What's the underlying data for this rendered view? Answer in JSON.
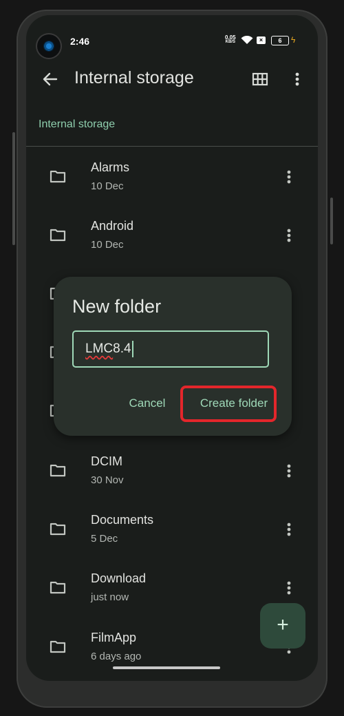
{
  "status_bar": {
    "time": "2:46",
    "net_speed": "0.05",
    "net_unit": "KB/S",
    "battery_level": "6"
  },
  "app_bar": {
    "title": "Internal storage"
  },
  "breadcrumb": "Internal storage",
  "folders": [
    {
      "name": "Alarms",
      "date": "10 Dec"
    },
    {
      "name": "Android",
      "date": "10 Dec"
    },
    {
      "name": "",
      "date": ""
    },
    {
      "name": "",
      "date": ""
    },
    {
      "name": "",
      "date": ""
    },
    {
      "name": "DCIM",
      "date": "30 Nov"
    },
    {
      "name": "Documents",
      "date": "5 Dec"
    },
    {
      "name": "Download",
      "date": "just now"
    },
    {
      "name": "FilmApp",
      "date": "6 days ago"
    }
  ],
  "dialog": {
    "title": "New folder",
    "input_word": "LMC",
    "input_rest": "8.4",
    "cancel_label": "Cancel",
    "create_label": "Create folder"
  },
  "fab": {
    "icon": "+"
  },
  "colors": {
    "accent": "#9fd9b8",
    "highlight": "#e3262b",
    "background": "#1a1d1b"
  }
}
